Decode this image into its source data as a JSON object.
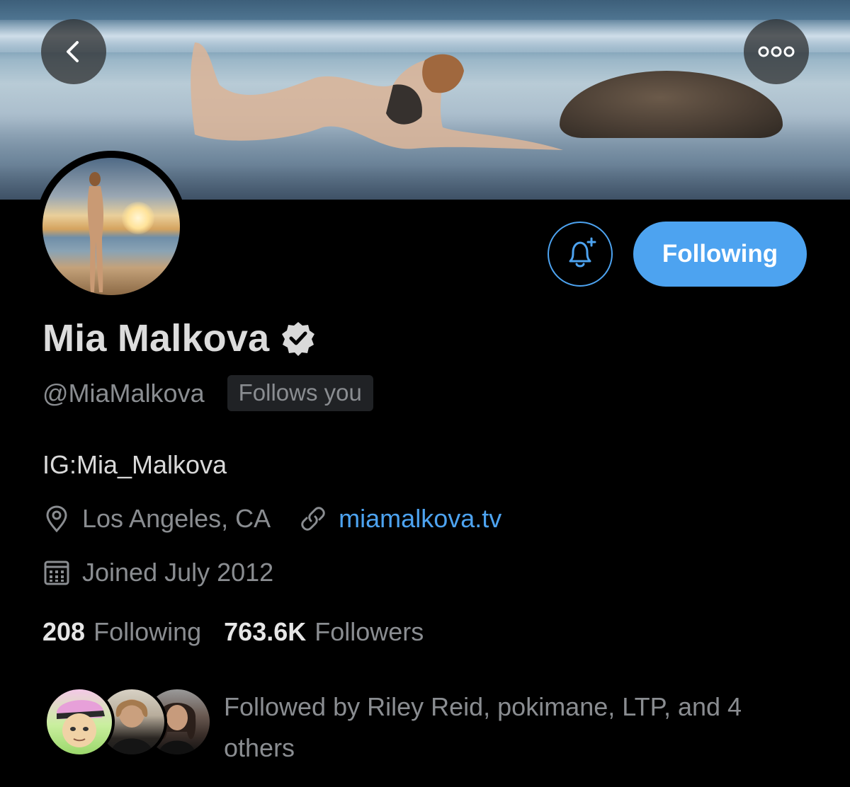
{
  "profile": {
    "display_name": "Mia Malkova",
    "handle": "@MiaMalkova",
    "follows_you_label": "Follows you",
    "bio": "IG:Mia_Malkova",
    "location": "Los Angeles, CA",
    "website": "miamalkova.tv",
    "joined": "Joined July 2012",
    "verified": true
  },
  "actions": {
    "following_label": "Following"
  },
  "stats": {
    "following_count": "208",
    "following_label": "Following",
    "followers_count": "763.6K",
    "followers_label": "Followers"
  },
  "followed_by": {
    "text": "Followed by Riley Reid, pokimane, LTP, and 4 others"
  },
  "icons": {
    "back": "chevron-left-icon",
    "more": "more-horizontal-icon",
    "notify": "bell-plus-icon",
    "verified": "verified-badge-icon",
    "location": "location-pin-icon",
    "link": "link-icon",
    "calendar": "calendar-icon"
  },
  "colors": {
    "accent": "#4da3f0",
    "background": "#000000",
    "secondary_text": "#8a8d91"
  }
}
